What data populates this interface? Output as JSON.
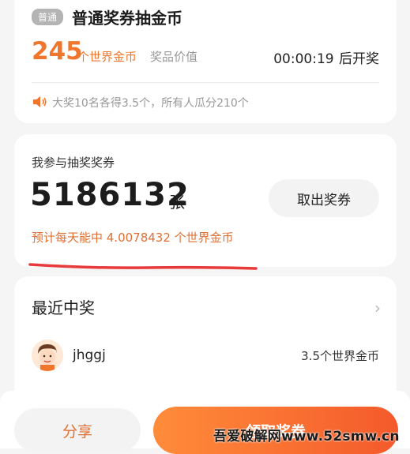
{
  "pool": {
    "badge": "普通",
    "title": "普通奖券抽金币",
    "coin_amount": "245",
    "coin_unit": "个世界金币",
    "prize_label": "奖品价值",
    "countdown_time": "00:00:19",
    "countdown_suffix": "后开奖",
    "notice": "大奖10名各得3.5个，所有人瓜分210个",
    "accent_color": "#f0762e"
  },
  "tickets": {
    "label": "我参与抽奖奖券",
    "count": "5186132",
    "unit": "张",
    "withdraw_label": "取出奖券",
    "daily_estimate": "预计每天能中 4.0078432 个世界金币"
  },
  "winners": {
    "title": "最近中奖",
    "items": [
      {
        "name": "jhggj",
        "prize": "3.5个世界金币"
      }
    ]
  },
  "bottom": {
    "share_label": "分享",
    "claim_label": "领取奖券"
  },
  "watermark": "吾爱破解网www.52smw.cn"
}
